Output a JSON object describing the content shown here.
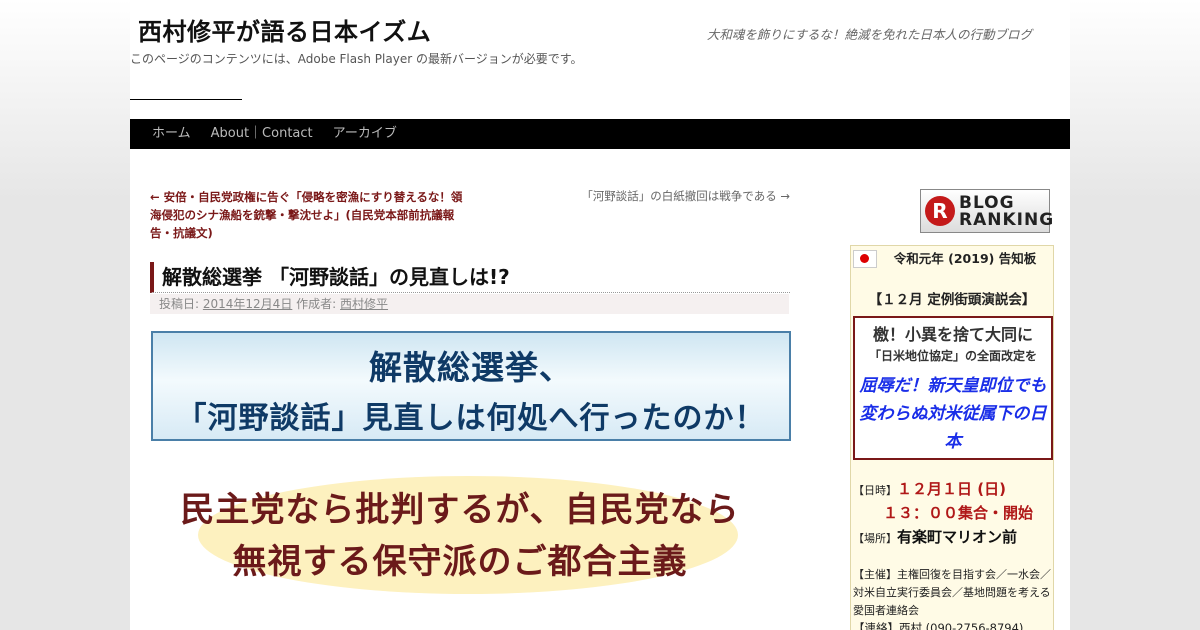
{
  "header": {
    "title": "西村修平が語る日本イズム",
    "description": "大和魂を飾りにするな！絶滅を免れた日本人の行動ブログ",
    "flash_notice": "このページのコンテンツには、Adobe Flash Player の最新バージョンが必要です。"
  },
  "nav": {
    "items": [
      "ホーム",
      "About｜Contact",
      "アーカイブ"
    ]
  },
  "post_nav": {
    "prev": "← 安倍・自民党政権に告ぐ「侵略を密漁にすり替えるな！領海侵犯のシナ漁船を銃撃・撃沈せよ」(自民党本部前抗議報告・抗議文)",
    "next": "「河野談話」の白紙撤回は戦争である →"
  },
  "post": {
    "title": "解散総選挙 「河野談話」の見直しは!?",
    "meta_prefix": "投稿日:",
    "date": "2014年12月4日",
    "author_prefix": "作成者:",
    "author": "西村修平"
  },
  "banner1": {
    "line1": "解散総選挙、",
    "line2": "「河野談話」見直しは何処へ行ったのか！"
  },
  "banner2": {
    "line1": "民主党なら批判するが、自民党なら",
    "line2": "無視する保守派のご都合主義"
  },
  "sidebar": {
    "ranking": {
      "badge": "R",
      "line1": "BLOG",
      "line2": "RANKING"
    },
    "notice": {
      "header": "令和元年 (2019) 告知板",
      "subheader": "【１２月 定例街頭演説会】",
      "box_line1": "檄！小異を捨て大同に",
      "box_line2": "「日米地位協定」の全面改定を",
      "box_line3": "屈辱だ！新天皇即位でも変わらぬ対米従属下の日本",
      "date_label": "【日時】",
      "date": "１２月１日 (日)",
      "time": "１３：００集合・開始",
      "place_label": "【場所】",
      "place": "有楽町マリオン前",
      "organizer": "【主催】主権回復を目指す会／一水会／対米自立実行委員会／基地問題を考える愛国者連絡会",
      "contact": "【連絡】西村 (090-2756-8794)"
    }
  },
  "colors": {
    "accent": "#7a1818",
    "nav_bg": "#000000",
    "banner_text": "#0f3a66",
    "notice_bg": "#fffbe6",
    "italic_blue": "#1a2ee8"
  }
}
